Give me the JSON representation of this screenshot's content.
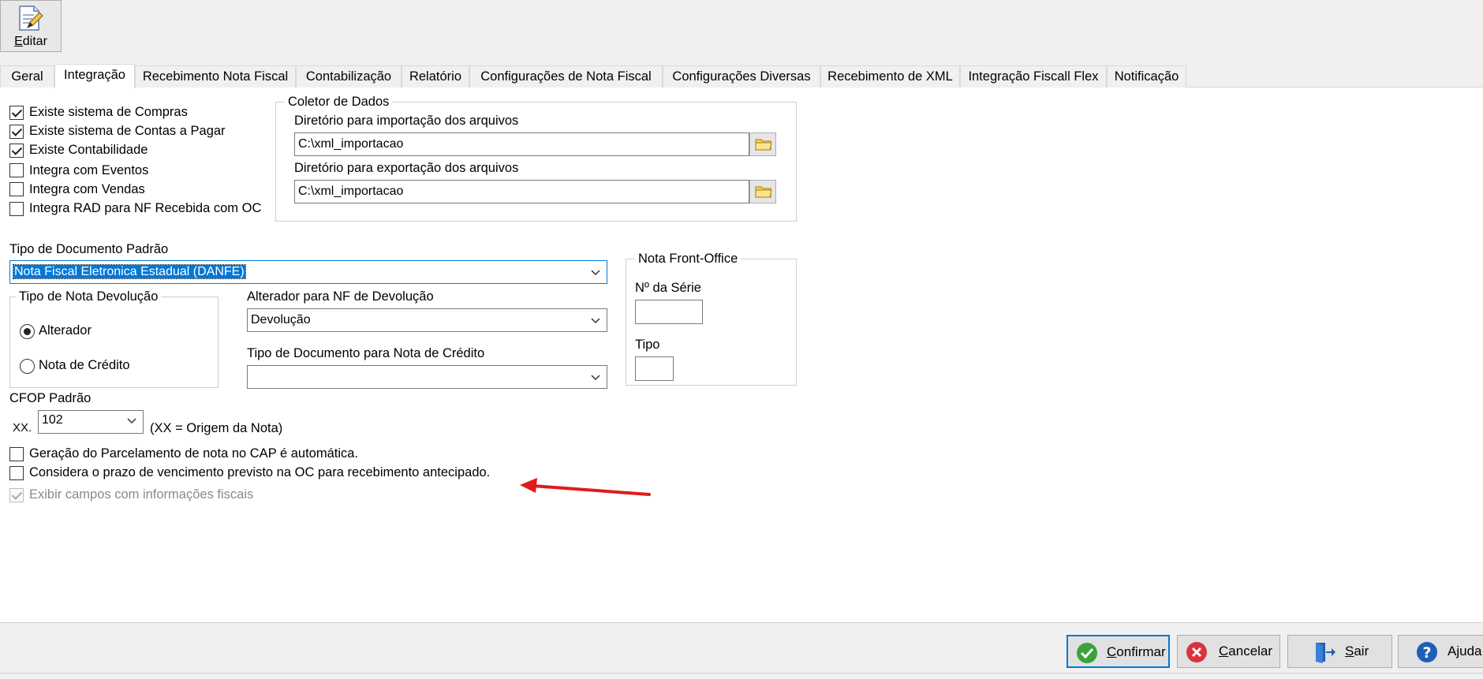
{
  "toolbar": {
    "edit_label": "Editar",
    "edit_mnemonic": "E",
    "edit_rest": "ditar"
  },
  "tabs": [
    {
      "label": "Geral"
    },
    {
      "label": "Integração"
    },
    {
      "label": "Recebimento Nota Fiscal"
    },
    {
      "label": "Contabilização"
    },
    {
      "label": "Relatório"
    },
    {
      "label": "Configurações de Nota Fiscal"
    },
    {
      "label": "Configurações Diversas"
    },
    {
      "label": "Recebimento de XML"
    },
    {
      "label": "Integração Fiscall Flex"
    },
    {
      "label": "Notificação"
    }
  ],
  "active_tab": "Integração",
  "integrations": [
    {
      "label": "Existe sistema de Compras",
      "checked": true
    },
    {
      "label": "Existe sistema de Contas a Pagar",
      "checked": true
    },
    {
      "label": "Existe Contabilidade",
      "checked": true
    },
    {
      "label": "Integra com Eventos",
      "checked": false
    },
    {
      "label": "Integra com Vendas",
      "checked": false
    },
    {
      "label": "Integra RAD para NF Recebida com OC",
      "checked": false
    }
  ],
  "coletor": {
    "title": "Coletor de Dados",
    "import_label": "Diretório para importação dos arquivos",
    "import_value": "C:\\xml_importacao",
    "export_label": "Diretório para exportação dos arquivos",
    "export_value": "C:\\xml_importacao"
  },
  "tipo_documento": {
    "label": "Tipo de Documento Padrão",
    "value": "Nota Fiscal Eletronica Estadual (DANFE)"
  },
  "tipo_nota_devolucao": {
    "title": "Tipo de Nota Devolução",
    "options": [
      {
        "label": "Alterador",
        "selected": true
      },
      {
        "label": "Nota de Crédito",
        "selected": false
      }
    ]
  },
  "alterador": {
    "label": "Alterador para NF de Devolução",
    "value": "Devolução"
  },
  "tipo_doc_credito": {
    "label": "Tipo de Documento para Nota de Crédito",
    "value": ""
  },
  "front_office": {
    "title": "Nota Front-Office",
    "serie_label": "Nº da Série",
    "serie_value": "",
    "tipo_label": "Tipo",
    "tipo_value": ""
  },
  "cfop": {
    "label": "CFOP Padrão",
    "prefix": "XX.",
    "value": "102",
    "hint": "(XX = Origem da Nota)"
  },
  "options": [
    {
      "label": "Geração do Parcelamento de nota no CAP é automática.",
      "checked": false,
      "disabled": false
    },
    {
      "label": "Considera o prazo de vencimento previsto na OC para recebimento antecipado.",
      "checked": false,
      "disabled": false
    },
    {
      "label": "Exibir campos com informações fiscais",
      "checked": true,
      "disabled": true
    }
  ],
  "buttons": {
    "confirmar": {
      "mn": "C",
      "rest": "onfirmar"
    },
    "cancelar": {
      "mn": "C",
      "rest": "ancelar"
    },
    "sair": {
      "mn": "S",
      "rest": "air"
    },
    "ajuda": {
      "mn": "",
      "rest": "Ajuda"
    }
  },
  "colors": {
    "accent": "#0078d7",
    "arrow": "#e01b1b",
    "confirm_icon": "#3aa33a",
    "cancel_icon": "#d9343a",
    "help_icon": "#1f5fb5"
  },
  "icons": [
    "edit-icon",
    "folder-icon",
    "chevron-down-icon",
    "check-circle-icon",
    "x-circle-icon",
    "exit-door-icon",
    "help-circle-icon"
  ]
}
